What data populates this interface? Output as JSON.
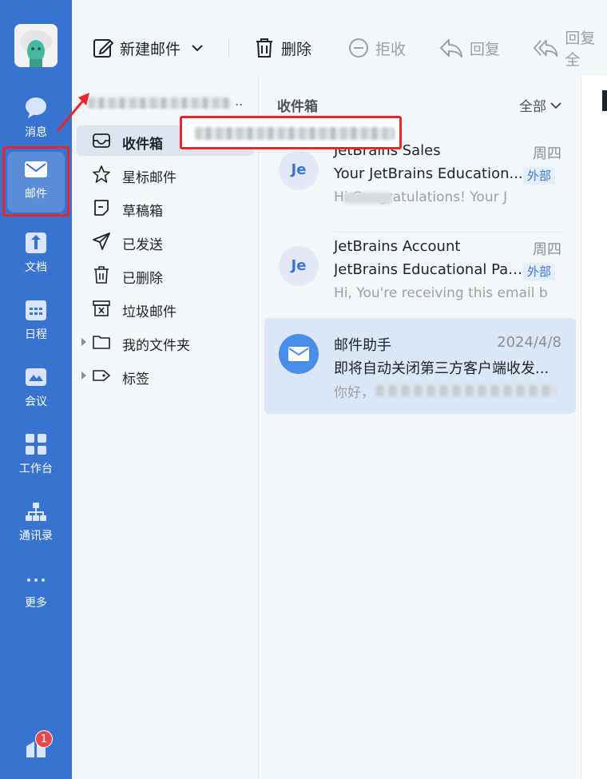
{
  "toolbar": {
    "new_mail": "新建邮件",
    "delete": "删除",
    "reject": "拒收",
    "reply": "回复",
    "reply_all": "回复全"
  },
  "rail": {
    "items": [
      {
        "label": "消息",
        "icon": "chat-bubble-icon"
      },
      {
        "label": "邮件",
        "icon": "envelope-icon",
        "active": true
      },
      {
        "label": "文档",
        "icon": "doc-icon"
      },
      {
        "label": "日程",
        "icon": "calendar-icon"
      },
      {
        "label": "会议",
        "icon": "meeting-icon"
      },
      {
        "label": "工作台",
        "icon": "apps-grid-icon"
      },
      {
        "label": "通讯录",
        "icon": "org-chart-icon"
      },
      {
        "label": "更多",
        "icon": "more-dots-icon"
      }
    ],
    "badge_count": "1"
  },
  "folders": {
    "items": [
      {
        "label": "收件箱",
        "icon": "inbox-icon",
        "active": true
      },
      {
        "label": "星标邮件",
        "icon": "star-icon"
      },
      {
        "label": "草稿箱",
        "icon": "draft-icon"
      },
      {
        "label": "已发送",
        "icon": "send-icon"
      },
      {
        "label": "已删除",
        "icon": "trash-icon"
      },
      {
        "label": "垃圾邮件",
        "icon": "spam-box-icon"
      },
      {
        "label": "我的文件夹",
        "icon": "folder-icon",
        "expandable": true
      },
      {
        "label": "标签",
        "icon": "tag-icon",
        "expandable": true
      }
    ]
  },
  "list": {
    "title": "收件箱",
    "filter": "全部",
    "mails": [
      {
        "avatar": "Je",
        "sender": "JetBrains Sales",
        "date": "周四",
        "subject": "Your JetBrains Education...",
        "tag": "外部",
        "preview": "Hi              Congratulations! Your J"
      },
      {
        "avatar": "Je",
        "sender": "JetBrains Account",
        "date": "周四",
        "subject": "JetBrains Educational Pac...",
        "tag": "外部",
        "preview": "Hi, You're receiving this email b"
      },
      {
        "avatar": "",
        "sender": "邮件助手",
        "date": "2024/4/8",
        "subject": "即将自动关闭第三方客户端收发...",
        "tag": "",
        "preview": "你好，"
      }
    ]
  },
  "colors": {
    "rail_bg": "#3873cf",
    "accent": "#3b76d2",
    "annotation_red": "#e8262b",
    "selected_row": "#dbe6f6"
  }
}
